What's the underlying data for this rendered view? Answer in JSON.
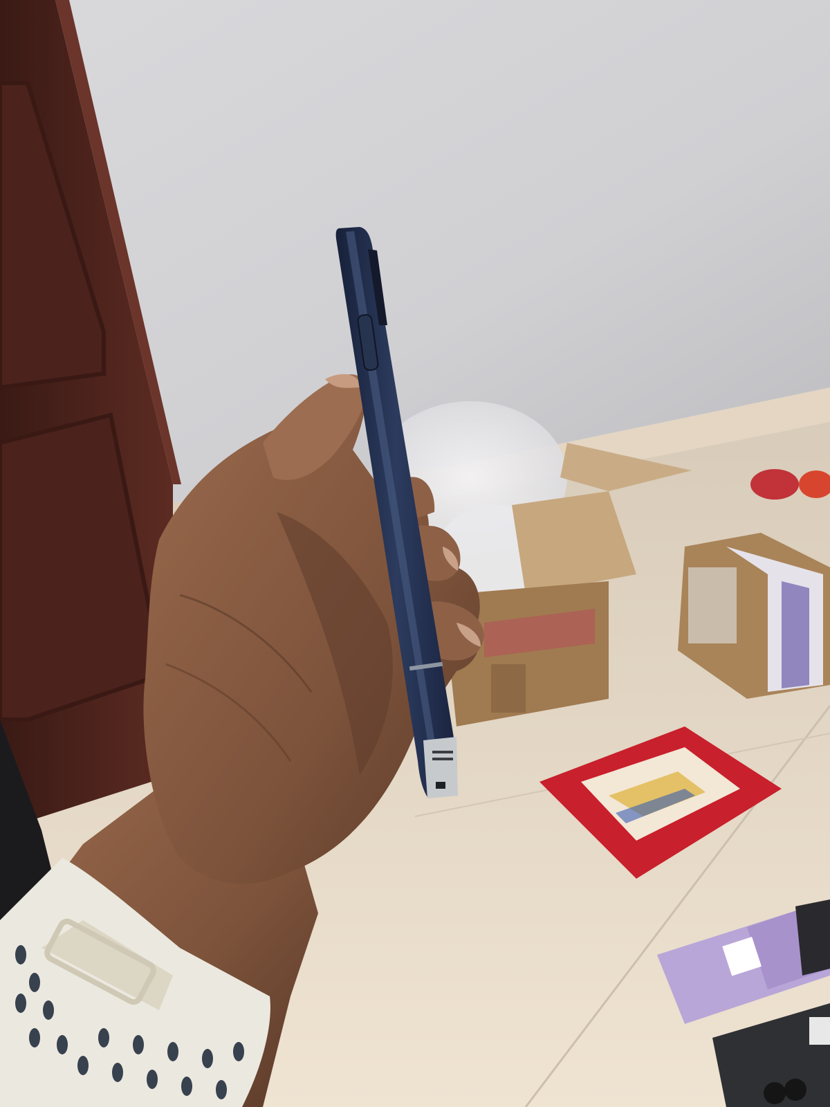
{
  "photo": {
    "subject": "phone-side-view-held-in-hand",
    "colors": {
      "wall": "#d4d4d7",
      "wall_shadow": "#b9b9bd",
      "door": "#4a211b",
      "door_panel": "#5a2a22",
      "floor": "#e6d9c8",
      "phone_frame": "#1f2c47",
      "phone_highlight": "#3a4a6a",
      "skin": "#8a5f45",
      "skin_shadow": "#5e3d2b",
      "watch_band": "#e9e6dc",
      "box": "#b08a60",
      "red_card": "#c8202c",
      "purple_card": "#b9a6d8"
    }
  }
}
